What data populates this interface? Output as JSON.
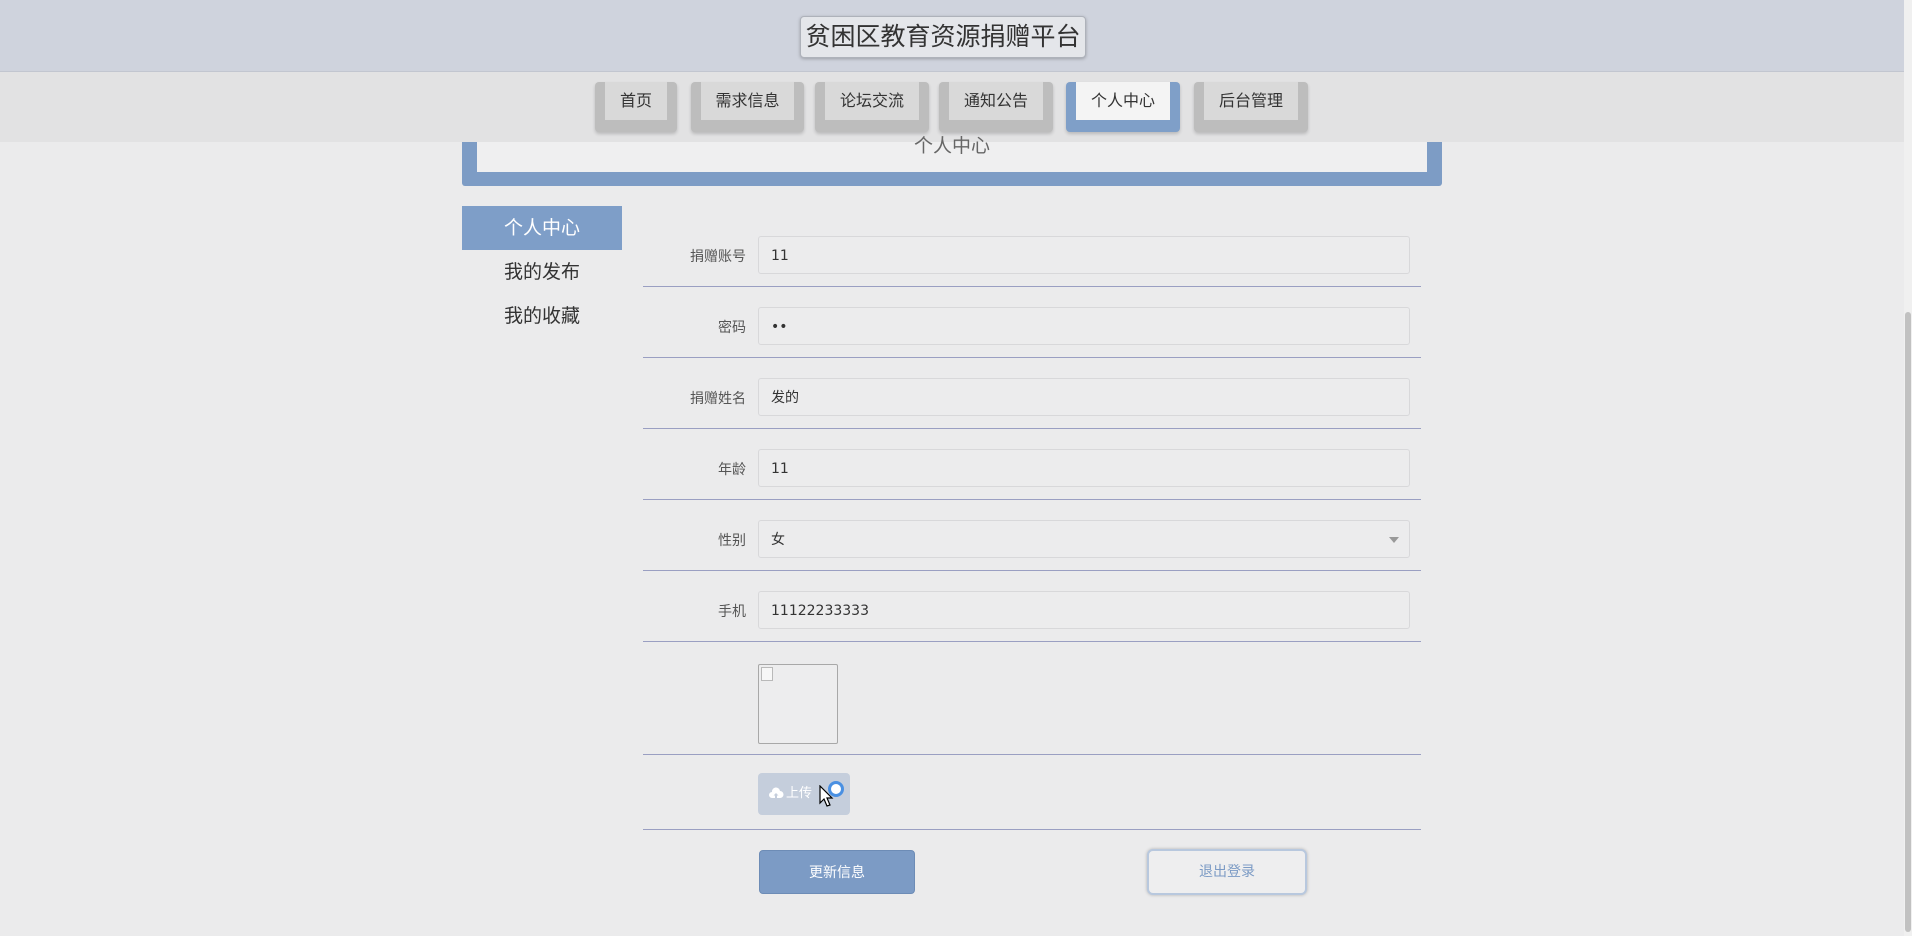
{
  "header": {
    "title": "贫困区教育资源捐赠平台"
  },
  "nav": {
    "tabs": [
      {
        "label": "首页",
        "active": false
      },
      {
        "label": "需求信息",
        "active": false
      },
      {
        "label": "论坛交流",
        "active": false
      },
      {
        "label": "通知公告",
        "active": false
      },
      {
        "label": "个人中心",
        "active": true
      },
      {
        "label": "后台管理",
        "active": false
      }
    ]
  },
  "banner": {
    "title": "个人中心"
  },
  "sidebar": {
    "items": [
      {
        "label": "个人中心",
        "active": true
      },
      {
        "label": "我的发布",
        "active": false
      },
      {
        "label": "我的收藏",
        "active": false
      }
    ]
  },
  "form": {
    "account": {
      "label": "捐赠账号",
      "value": "11"
    },
    "password": {
      "label": "密码",
      "value": "••"
    },
    "name": {
      "label": "捐赠姓名",
      "value": "发的"
    },
    "age": {
      "label": "年龄",
      "value": "11"
    },
    "gender": {
      "label": "性别",
      "value": "女"
    },
    "phone": {
      "label": "手机",
      "value": "11122233333"
    },
    "upload_label": "上传"
  },
  "actions": {
    "update_label": "更新信息",
    "logout_label": "退出登录"
  },
  "colors": {
    "accent": "#7d9cc5",
    "header_bg": "#cfd3dd",
    "page_bg": "#ebebec"
  },
  "icons": {
    "upload": "cloud-upload-icon",
    "select": "chevron-down-icon"
  }
}
